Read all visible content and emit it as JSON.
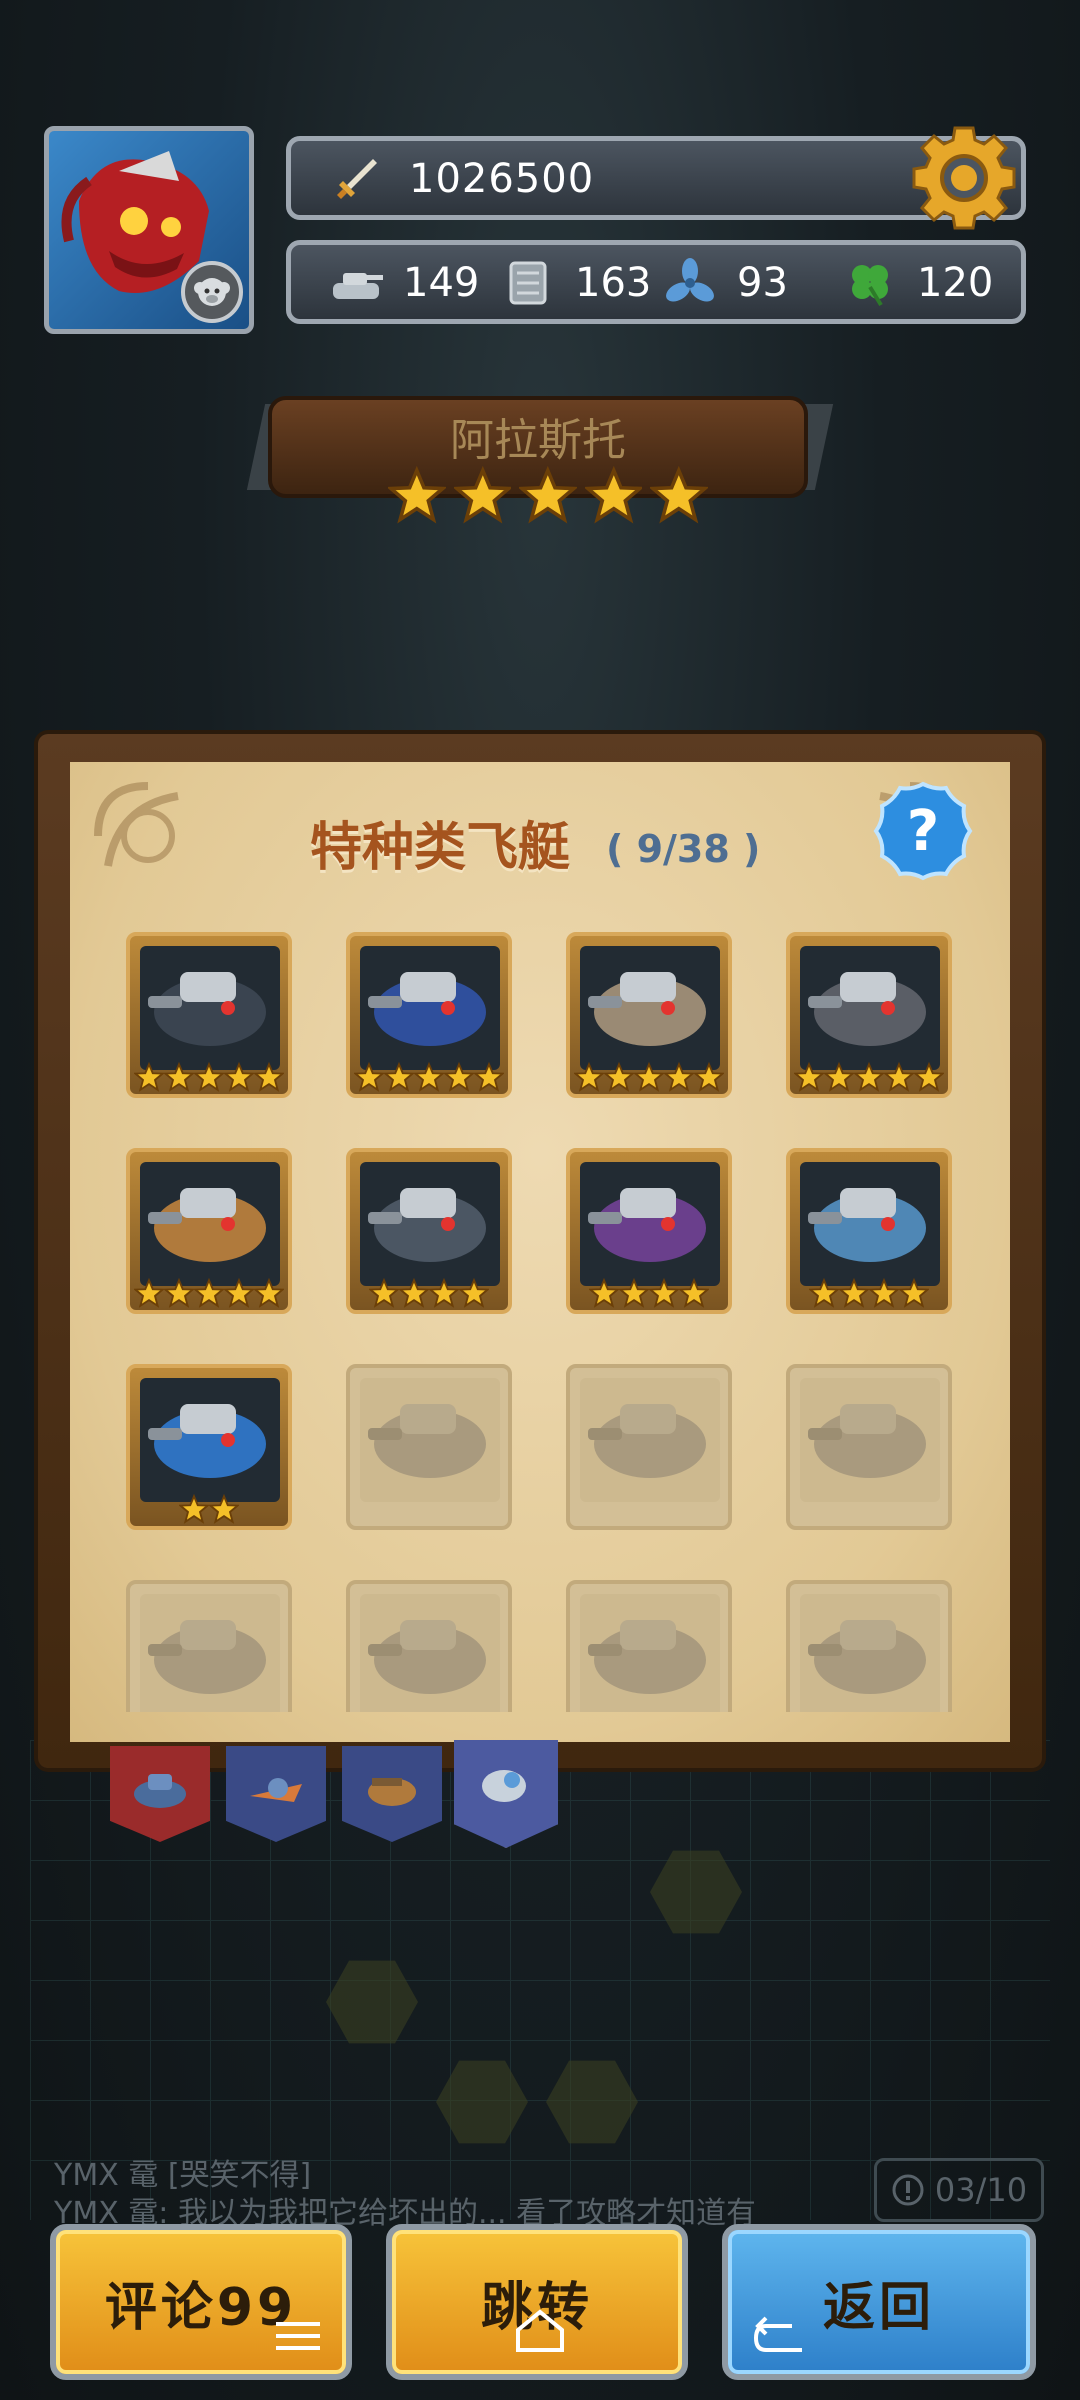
{
  "profile": {
    "avatar_icon": "red-mech-avatar",
    "badge_icon": "monkey-badge-icon"
  },
  "stats": {
    "power": "1026500",
    "resources": [
      {
        "name": "tank-parts",
        "icon": "tank-icon",
        "value": "149"
      },
      {
        "name": "armor-plates",
        "icon": "plates-icon",
        "value": "163"
      },
      {
        "name": "propellers",
        "icon": "propeller-icon",
        "value": "93"
      },
      {
        "name": "clovers",
        "icon": "clover-icon",
        "value": "120"
      }
    ]
  },
  "ship": {
    "name": "阿拉斯托",
    "stars": 5
  },
  "panel": {
    "title": "特种类飞艇",
    "count": "( 9/38 )",
    "items": [
      {
        "stars": 5,
        "unlocked": true,
        "color": "#3a4450"
      },
      {
        "stars": 5,
        "unlocked": true,
        "color": "#2f4f9c"
      },
      {
        "stars": 5,
        "unlocked": true,
        "color": "#9a8a74"
      },
      {
        "stars": 5,
        "unlocked": true,
        "color": "#5a5e66"
      },
      {
        "stars": 5,
        "unlocked": true,
        "color": "#b07a3c"
      },
      {
        "stars": 4,
        "unlocked": true,
        "color": "#4b5663"
      },
      {
        "stars": 4,
        "unlocked": true,
        "color": "#6a3f8c"
      },
      {
        "stars": 4,
        "unlocked": true,
        "color": "#4f87b5"
      },
      {
        "stars": 2,
        "unlocked": true,
        "color": "#2f72c0"
      },
      {
        "stars": 0,
        "unlocked": false
      },
      {
        "stars": 0,
        "unlocked": false
      },
      {
        "stars": 0,
        "unlocked": false
      },
      {
        "stars": 0,
        "unlocked": false
      },
      {
        "stars": 0,
        "unlocked": false
      },
      {
        "stars": 0,
        "unlocked": false
      },
      {
        "stars": 0,
        "unlocked": false
      }
    ]
  },
  "chat": {
    "line1": "YMX 鼋 [哭笑不得]",
    "line2": "YMX 鼋: 我以为我把它给坏出的... 看了攻略才知道有可",
    "page": "03/10"
  },
  "buttons": {
    "comment": "评论99",
    "jump": "跳转",
    "back": "返回"
  },
  "colors": {
    "gold": "#f2b22a",
    "blue": "#3d93d9",
    "title": "#a5541e",
    "count": "#4e6e92"
  }
}
